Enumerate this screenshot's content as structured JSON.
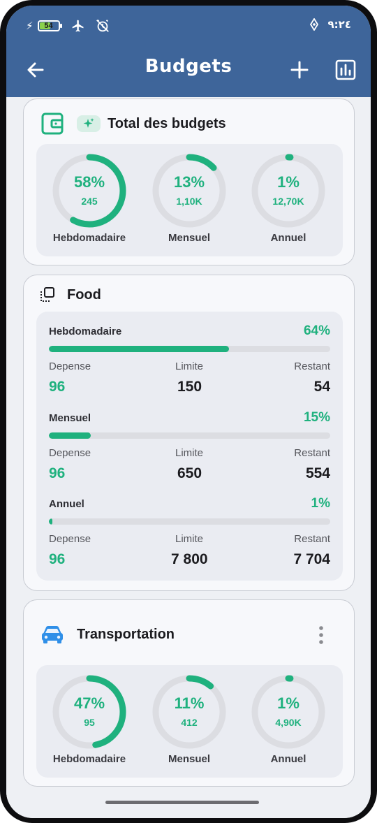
{
  "status": {
    "battery": "54",
    "time": "٩:٢٤"
  },
  "header": {
    "title": "Budgets"
  },
  "total": {
    "title": "Total des budgets",
    "gauges": [
      {
        "pct": "58%",
        "fraction": 0.58,
        "amount": "245",
        "label": "Hebdomadaire"
      },
      {
        "pct": "13%",
        "fraction": 0.13,
        "amount": "1,10K",
        "label": "Mensuel"
      },
      {
        "pct": "1%",
        "fraction": 0.01,
        "amount": "12,70K",
        "label": "Annuel"
      }
    ]
  },
  "food": {
    "title": "Food",
    "periods": [
      {
        "name": "Hebdomadaire",
        "pct": "64%",
        "fraction": 0.64,
        "depense_label": "Depense",
        "limite_label": "Limite",
        "restant_label": "Restant",
        "depense": "96",
        "limite": "150",
        "restant": "54"
      },
      {
        "name": "Mensuel",
        "pct": "15%",
        "fraction": 0.15,
        "depense_label": "Depense",
        "limite_label": "Limite",
        "restant_label": "Restant",
        "depense": "96",
        "limite": "650",
        "restant": "554"
      },
      {
        "name": "Annuel",
        "pct": "1%",
        "fraction": 0.01,
        "depense_label": "Depense",
        "limite_label": "Limite",
        "restant_label": "Restant",
        "depense": "96",
        "limite": "7 800",
        "restant": "7 704"
      }
    ]
  },
  "transportation": {
    "title": "Transportation",
    "gauges": [
      {
        "pct": "47%",
        "fraction": 0.47,
        "amount": "95",
        "label": "Hebdomadaire"
      },
      {
        "pct": "11%",
        "fraction": 0.11,
        "amount": "412",
        "label": "Mensuel"
      },
      {
        "pct": "1%",
        "fraction": 0.01,
        "amount": "4,90K",
        "label": "Annuel"
      }
    ]
  },
  "colors": {
    "appbar": "#3e659a",
    "accent": "#1fb17e",
    "track": "#dcdde2",
    "car": "#2f8fe8"
  }
}
